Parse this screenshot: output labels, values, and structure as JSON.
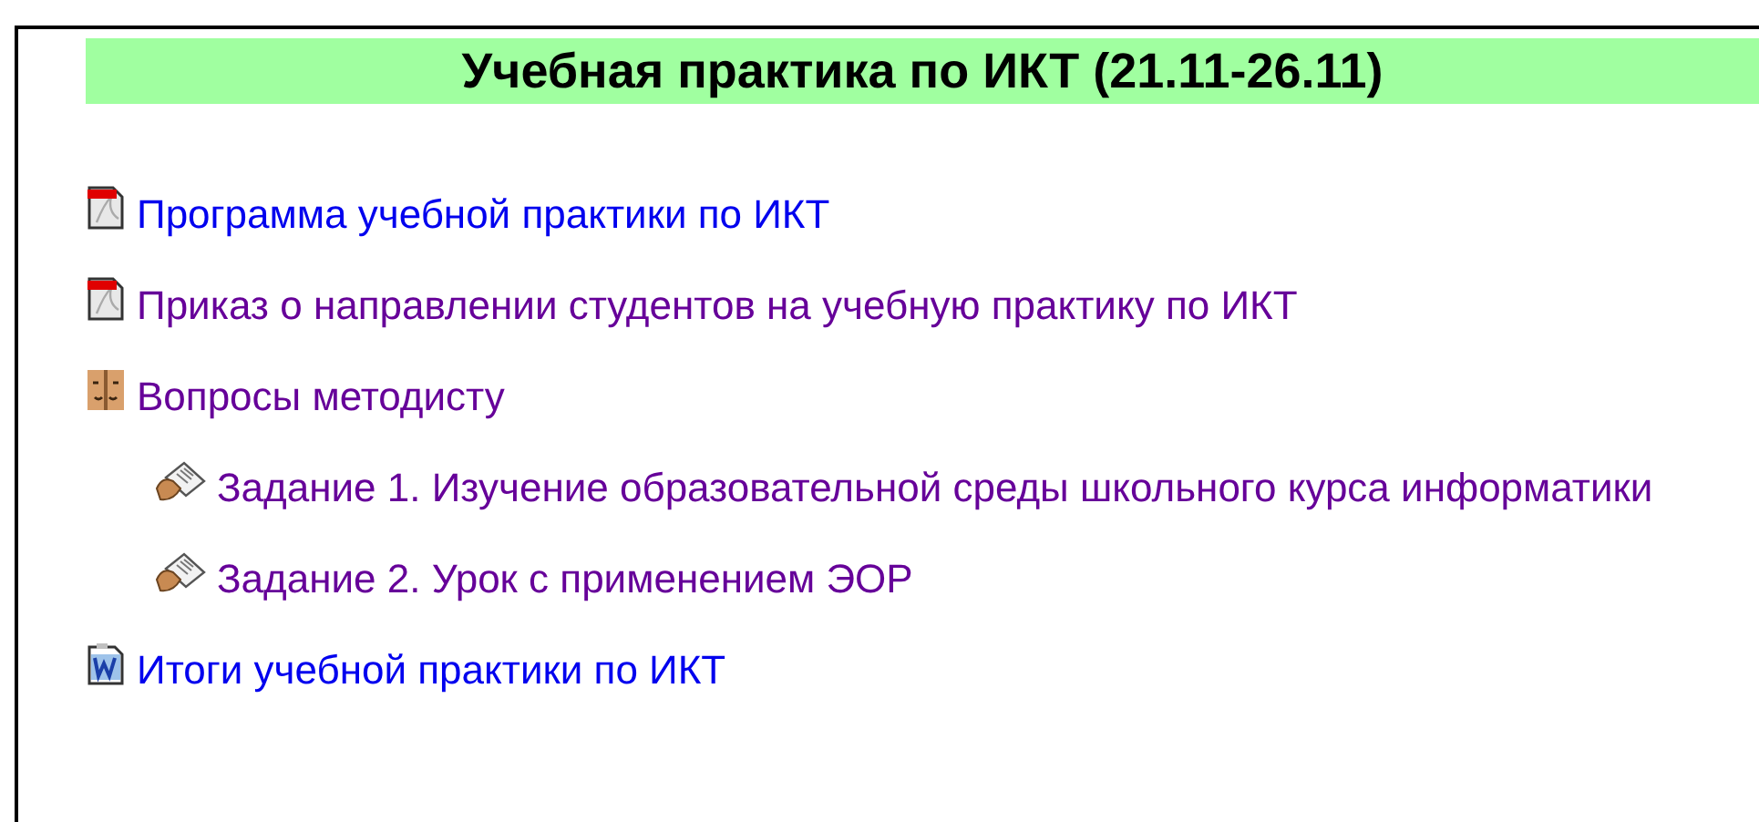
{
  "section": {
    "title": "Учебная практика по ИКТ (21.11-26.11)"
  },
  "items": [
    {
      "kind": "pdf",
      "label": "Программа учебной практики по ИКТ",
      "visited": false
    },
    {
      "kind": "pdf",
      "label": "Приказ о направлении студентов на учебную практику по ИКТ",
      "visited": true
    },
    {
      "kind": "forum",
      "label": "Вопросы методисту",
      "visited": true,
      "children": [
        {
          "kind": "assignment",
          "label": "Задание 1. Изучение образовательной среды школьного курса информатики",
          "visited": true
        },
        {
          "kind": "assignment",
          "label": "Задание 2. Урок с применением ЭОР",
          "visited": true
        }
      ]
    },
    {
      "kind": "word",
      "label": "Итоги учебной практики по ИКТ",
      "visited": false
    }
  ]
}
